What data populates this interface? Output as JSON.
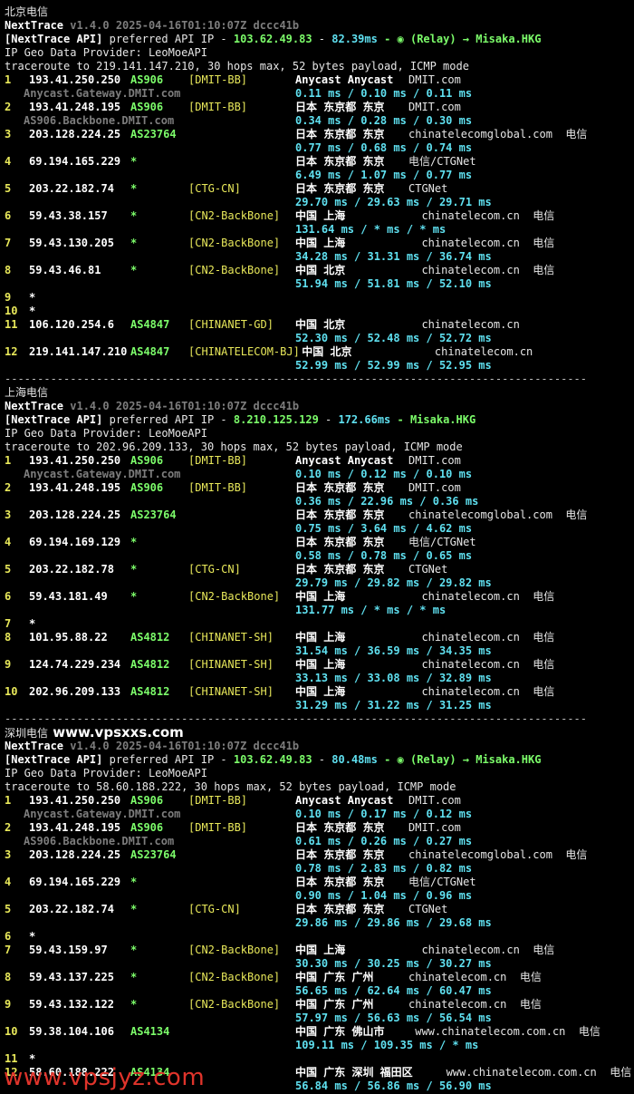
{
  "watermark": "www.vpsjyz.com",
  "sections": [
    {
      "title": "北京电信",
      "site": "",
      "version": {
        "name": "NextTrace",
        "ver": "v1.4.0 2025-04-16T01:10:07Z dccc41b"
      },
      "api": {
        "prefix": "[NextTrace API]",
        "text": "preferred API IP - ",
        "ip": "103.62.49.83",
        "dash": " - ",
        "ms": "82.39ms",
        "relay": " - ◉ (Relay) → Misaka.HKG"
      },
      "geo_provider": "IP Geo Data Provider: LeoMoeAPI",
      "traceroute": "traceroute to 219.141.147.210, 30 hops max, 52 bytes payload, ICMP mode",
      "hops": [
        {
          "n": "1",
          "ip": "193.41.250.250",
          "as": "AS906",
          "tag": "[DMIT-BB]",
          "geo": "Anycast Anycast",
          "dom": "DMIT.com",
          "sub": "Anycast.Gateway.DMIT.com",
          "rtt": "0.11 ms / 0.10 ms / 0.11 ms"
        },
        {
          "n": "2",
          "ip": "193.41.248.195",
          "as": "AS906",
          "tag": "[DMIT-BB]",
          "geo": "日本 东京都 东京",
          "dom": "DMIT.com",
          "sub": "AS906.Backbone.DMIT.com",
          "rtt": "0.34 ms / 0.28 ms / 0.30 ms"
        },
        {
          "n": "3",
          "ip": "203.128.224.25",
          "as": "AS23764",
          "tag": "",
          "geo": "日本 东京都 东京",
          "dom": "chinatelecomglobal.com  电信",
          "sub": "",
          "rtt": "0.77 ms / 0.68 ms / 0.74 ms"
        },
        {
          "n": "4",
          "ip": "69.194.165.229",
          "as": "*",
          "tag": "",
          "geo": "日本 东京都 东京",
          "dom": "电信/CTGNet",
          "sub": "",
          "rtt": "6.49 ms / 1.07 ms / 0.77 ms"
        },
        {
          "n": "5",
          "ip": "203.22.182.74",
          "as": "*",
          "tag": "[CTG-CN]",
          "geo": "日本 东京都 东京",
          "dom": "CTGNet",
          "sub": "",
          "rtt": "29.70 ms / 29.63 ms / 29.71 ms"
        },
        {
          "n": "6",
          "ip": "59.43.38.157",
          "as": "*",
          "tag": "[CN2-BackBone]",
          "geo": "中国 上海",
          "dom": "  chinatelecom.cn  电信",
          "sub": "",
          "rtt": "131.64 ms / * ms / * ms"
        },
        {
          "n": "7",
          "ip": "59.43.130.205",
          "as": "*",
          "tag": "[CN2-BackBone]",
          "geo": "中国 上海",
          "dom": "  chinatelecom.cn  电信",
          "sub": "",
          "rtt": "34.28 ms / 31.31 ms / 36.74 ms"
        },
        {
          "n": "8",
          "ip": "59.43.46.81",
          "as": "*",
          "tag": "[CN2-BackBone]",
          "geo": "中国 北京",
          "dom": "  chinatelecom.cn  电信",
          "sub": "",
          "rtt": "51.94 ms / 51.81 ms / 52.10 ms"
        },
        {
          "n": "9",
          "ip": "*",
          "as": "",
          "tag": "",
          "geo": "",
          "dom": "",
          "sub": "",
          "rtt": ""
        },
        {
          "n": "10",
          "ip": "*",
          "as": "",
          "tag": "",
          "geo": "",
          "dom": "",
          "sub": "",
          "rtt": ""
        },
        {
          "n": "11",
          "ip": "106.120.254.6",
          "as": "AS4847",
          "tag": "[CHINANET-GD]",
          "geo": "中国 北京",
          "dom": "  chinatelecom.cn",
          "sub": "",
          "rtt": "52.30 ms / 52.48 ms / 52.72 ms"
        },
        {
          "n": "12",
          "ip": "219.141.147.210",
          "as": "AS4847",
          "tag": "[CHINATELECOM-BJ]",
          "geo": " 中国 北京",
          "dom": "    chinatelecom.cn",
          "sub": "",
          "rtt": "52.99 ms / 52.99 ms / 52.95 ms"
        }
      ]
    },
    {
      "title": "上海电信",
      "site": "",
      "version": {
        "name": "NextTrace",
        "ver": "v1.4.0 2025-04-16T01:10:07Z dccc41b"
      },
      "api": {
        "prefix": "[NextTrace API]",
        "text": "preferred API IP - ",
        "ip": "8.210.125.129",
        "dash": " - ",
        "ms": "172.66ms",
        "relay": " - Misaka.HKG"
      },
      "geo_provider": "IP Geo Data Provider: LeoMoeAPI",
      "traceroute": "traceroute to 202.96.209.133, 30 hops max, 52 bytes payload, ICMP mode",
      "hops": [
        {
          "n": "1",
          "ip": "193.41.250.250",
          "as": "AS906",
          "tag": "[DMIT-BB]",
          "geo": "Anycast Anycast",
          "dom": "DMIT.com",
          "sub": "Anycast.Gateway.DMIT.com",
          "rtt": "0.10 ms / 0.12 ms / 0.10 ms"
        },
        {
          "n": "2",
          "ip": "193.41.248.195",
          "as": "AS906",
          "tag": "[DMIT-BB]",
          "geo": "日本 东京都 东京",
          "dom": "DMIT.com",
          "sub": "",
          "rtt": "0.36 ms / 22.96 ms / 0.36 ms"
        },
        {
          "n": "3",
          "ip": "203.128.224.25",
          "as": "AS23764",
          "tag": "",
          "geo": "日本 东京都 东京",
          "dom": "chinatelecomglobal.com  电信",
          "sub": "",
          "rtt": "0.75 ms / 3.64 ms / 4.62 ms"
        },
        {
          "n": "4",
          "ip": "69.194.169.129",
          "as": "*",
          "tag": "",
          "geo": "日本 东京都 东京",
          "dom": "电信/CTGNet",
          "sub": "",
          "rtt": "0.58 ms / 0.78 ms / 0.65 ms"
        },
        {
          "n": "5",
          "ip": "203.22.182.78",
          "as": "*",
          "tag": "[CTG-CN]",
          "geo": "日本 东京都 东京",
          "dom": "CTGNet",
          "sub": "",
          "rtt": "29.79 ms / 29.82 ms / 29.82 ms"
        },
        {
          "n": "6",
          "ip": "59.43.181.49",
          "as": "*",
          "tag": "[CN2-BackBone]",
          "geo": "中国 上海",
          "dom": "  chinatelecom.cn  电信",
          "sub": "",
          "rtt": "131.77 ms / * ms / * ms"
        },
        {
          "n": "7",
          "ip": "*",
          "as": "",
          "tag": "",
          "geo": "",
          "dom": "",
          "sub": "",
          "rtt": ""
        },
        {
          "n": "8",
          "ip": "101.95.88.22",
          "as": "AS4812",
          "tag": "[CHINANET-SH]",
          "geo": "中国 上海",
          "dom": "  chinatelecom.cn  电信",
          "sub": "",
          "rtt": "31.54 ms / 36.59 ms / 34.35 ms"
        },
        {
          "n": "9",
          "ip": "124.74.229.234",
          "as": "AS4812",
          "tag": "[CHINANET-SH]",
          "geo": "中国 上海",
          "dom": "  chinatelecom.cn  电信",
          "sub": "",
          "rtt": "33.13 ms / 33.08 ms / 32.89 ms"
        },
        {
          "n": "10",
          "ip": "202.96.209.133",
          "as": "AS4812",
          "tag": "[CHINANET-SH]",
          "geo": "中国 上海",
          "dom": "  chinatelecom.cn  电信",
          "sub": "",
          "rtt": "31.29 ms / 31.22 ms / 31.25 ms"
        }
      ]
    },
    {
      "title": "深圳电信",
      "site": "www.vpsxxs.com",
      "version": {
        "name": "NextTrace",
        "ver": "v1.4.0 2025-04-16T01:10:07Z dccc41b"
      },
      "api": {
        "prefix": "[NextTrace API]",
        "text": "preferred API IP - ",
        "ip": "103.62.49.83",
        "dash": " - ",
        "ms": "80.48ms",
        "relay": " - ◉ (Relay) → Misaka.HKG"
      },
      "geo_provider": "IP Geo Data Provider: LeoMoeAPI",
      "traceroute": "traceroute to 58.60.188.222, 30 hops max, 52 bytes payload, ICMP mode",
      "hops": [
        {
          "n": "1",
          "ip": "193.41.250.250",
          "as": "AS906",
          "tag": "[DMIT-BB]",
          "geo": "Anycast Anycast",
          "dom": "DMIT.com",
          "sub": "Anycast.Gateway.DMIT.com",
          "rtt": "0.10 ms / 0.17 ms / 0.12 ms"
        },
        {
          "n": "2",
          "ip": "193.41.248.195",
          "as": "AS906",
          "tag": "[DMIT-BB]",
          "geo": "日本 东京都 东京",
          "dom": "DMIT.com",
          "sub": "AS906.Backbone.DMIT.com",
          "rtt": "0.61 ms / 0.26 ms / 0.27 ms"
        },
        {
          "n": "3",
          "ip": "203.128.224.25",
          "as": "AS23764",
          "tag": "",
          "geo": "日本 东京都 东京",
          "dom": "chinatelecomglobal.com  电信",
          "sub": "",
          "rtt": "0.78 ms / 2.83 ms / 0.82 ms"
        },
        {
          "n": "4",
          "ip": "69.194.165.229",
          "as": "*",
          "tag": "",
          "geo": "日本 东京都 东京",
          "dom": "电信/CTGNet",
          "sub": "",
          "rtt": "0.90 ms / 1.04 ms / 0.96 ms"
        },
        {
          "n": "5",
          "ip": "203.22.182.74",
          "as": "*",
          "tag": "[CTG-CN]",
          "geo": "日本 东京都 东京",
          "dom": "CTGNet",
          "sub": "",
          "rtt": "29.86 ms / 29.86 ms / 29.68 ms"
        },
        {
          "n": "6",
          "ip": "*",
          "as": "",
          "tag": "",
          "geo": "",
          "dom": "",
          "sub": "",
          "rtt": ""
        },
        {
          "n": "7",
          "ip": "59.43.159.97",
          "as": "*",
          "tag": "[CN2-BackBone]",
          "geo": "中国 上海",
          "dom": "  chinatelecom.cn  电信",
          "sub": "",
          "rtt": "30.30 ms / 30.25 ms / 30.27 ms"
        },
        {
          "n": "8",
          "ip": "59.43.137.225",
          "as": "*",
          "tag": "[CN2-BackBone]",
          "geo": "中国 广东 广州",
          "dom": "chinatelecom.cn  电信",
          "sub": "",
          "rtt": "56.65 ms / 62.64 ms / 60.47 ms"
        },
        {
          "n": "9",
          "ip": "59.43.132.122",
          "as": "*",
          "tag": "[CN2-BackBone]",
          "geo": "中国 广东 广州",
          "dom": "chinatelecom.cn  电信",
          "sub": "",
          "rtt": "57.97 ms / 56.63 ms / 56.54 ms"
        },
        {
          "n": "10",
          "ip": "59.38.104.106",
          "as": "AS4134",
          "tag": "",
          "geo": "中国 广东 佛山市",
          "dom": " www.chinatelecom.com.cn  电信",
          "sub": "",
          "rtt": "109.11 ms / 109.35 ms / * ms"
        },
        {
          "n": "11",
          "ip": "*",
          "as": "",
          "tag": "",
          "geo": "",
          "dom": "",
          "sub": "",
          "rtt": ""
        },
        {
          "n": "12",
          "ip": "58.60.188.222",
          "as": "AS4134",
          "tag": "",
          "geo": "中国 广东 深圳 福田区",
          "dom": "    www.chinatelecom.com.cn  电信",
          "sub": "",
          "rtt": "56.84 ms / 56.86 ms / 56.90 ms"
        }
      ]
    }
  ],
  "separator": "-----------------------------------------------------------------------------------------"
}
